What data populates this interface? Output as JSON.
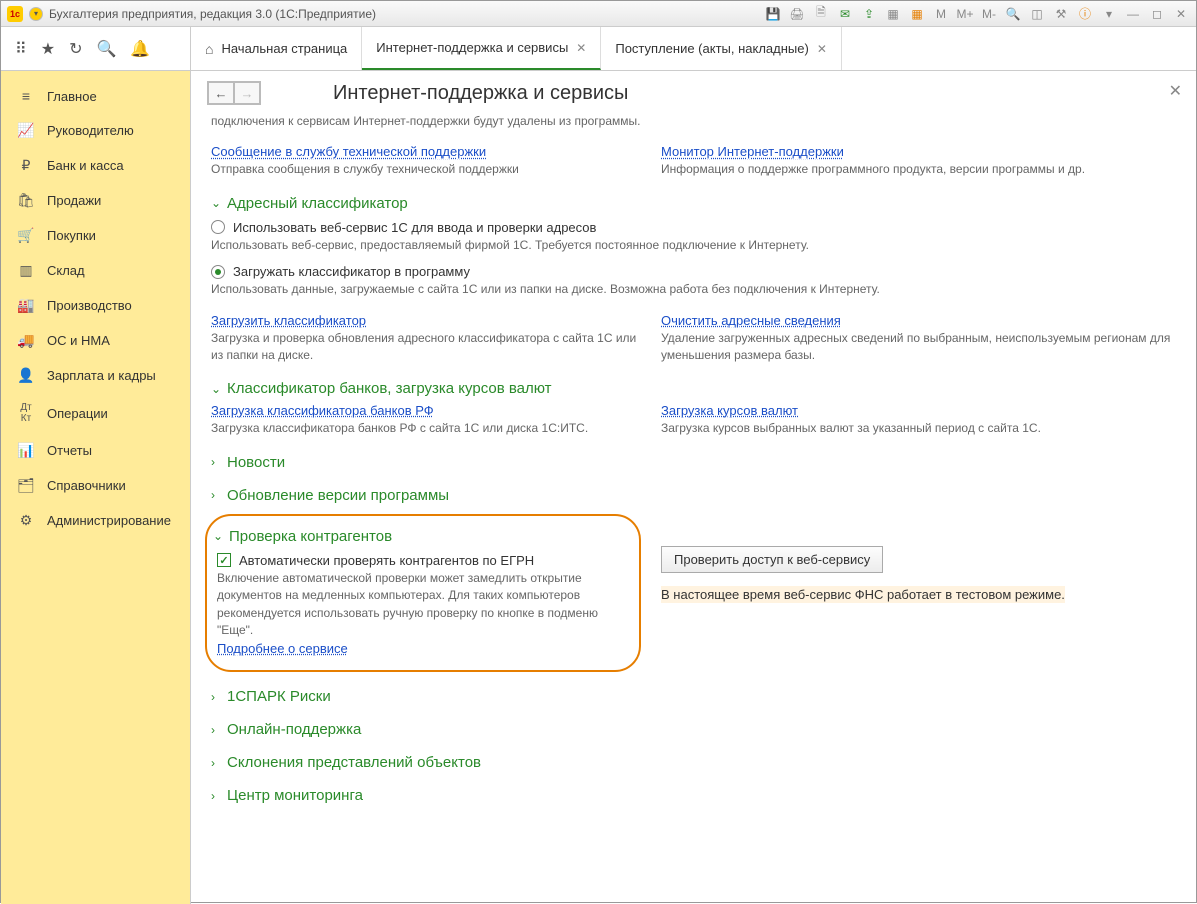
{
  "titlebar": {
    "title": "Бухгалтерия предприятия, редакция 3.0  (1С:Предприятие)"
  },
  "tabs": {
    "home": "Начальная страница",
    "t1": "Интернет-поддержка и сервисы",
    "t2": "Поступление (акты, накладные)"
  },
  "sidebar": {
    "items": [
      {
        "label": "Главное"
      },
      {
        "label": "Руководителю"
      },
      {
        "label": "Банк и касса"
      },
      {
        "label": "Продажи"
      },
      {
        "label": "Покупки"
      },
      {
        "label": "Склад"
      },
      {
        "label": "Производство"
      },
      {
        "label": "ОС и НМА"
      },
      {
        "label": "Зарплата и кадры"
      },
      {
        "label": "Операции"
      },
      {
        "label": "Отчеты"
      },
      {
        "label": "Справочники"
      },
      {
        "label": "Администрирование"
      }
    ]
  },
  "page": {
    "title": "Интернет-поддержка и сервисы",
    "intro_desc": "подключения к сервисам Интернет-поддержки будут удалены из программы.",
    "support_msg_link": "Сообщение в службу технической поддержки",
    "support_msg_desc": "Отправка сообщения в службу технической поддержки",
    "monitor_link": "Монитор Интернет-поддержки",
    "monitor_desc": "Информация о поддержке программного продукта, версии программы и др.",
    "addr_title": "Адресный классификатор",
    "addr_radio1": "Использовать веб-сервис 1С для ввода и проверки адресов",
    "addr_radio1_desc": "Использовать веб-сервис, предоставляемый фирмой 1С. Требуется постоянное подключение к Интернету.",
    "addr_radio2": "Загружать классификатор в программу",
    "addr_radio2_desc": "Использовать данные, загружаемые с сайта 1С или из папки на диске. Возможна работа без подключения к Интернету.",
    "load_class_link": "Загрузить классификатор",
    "load_class_desc": "Загрузка и проверка обновления адресного классификатора с сайта 1С или из папки на диске.",
    "clear_addr_link": "Очистить адресные сведения",
    "clear_addr_desc": "Удаление загруженных адресных сведений по выбранным, неиспользуемым регионам для уменьшения размера базы.",
    "banks_title": "Классификатор банков, загрузка курсов валют",
    "banks_link": "Загрузка классификатора банков РФ",
    "banks_desc": "Загрузка классификатора банков РФ с сайта 1С или диска 1С:ИТС.",
    "rates_link": "Загрузка курсов валют",
    "rates_desc": "Загрузка курсов выбранных валют за указанный период с сайта 1С.",
    "news_title": "Новости",
    "update_title": "Обновление версии программы",
    "check_title": "Проверка контрагентов",
    "check_box": "Автоматически проверять контрагентов по ЕГРН",
    "check_desc": "Включение автоматической проверки может замедлить открытие документов на медленных компьютерах. Для таких компьютеров рекомендуется использовать ручную проверку по кнопке в подменю \"Еще\".",
    "check_more": "Подробнее о сервисе",
    "check_btn": "Проверить доступ к веб-сервису",
    "check_warn": "В настоящее время веб-сервис ФНС работает в тестовом режиме.",
    "spark_title": "1СПАРК Риски",
    "online_title": "Онлайн-поддержка",
    "decl_title": "Склонения представлений объектов",
    "monitor_center_title": "Центр мониторинга"
  }
}
